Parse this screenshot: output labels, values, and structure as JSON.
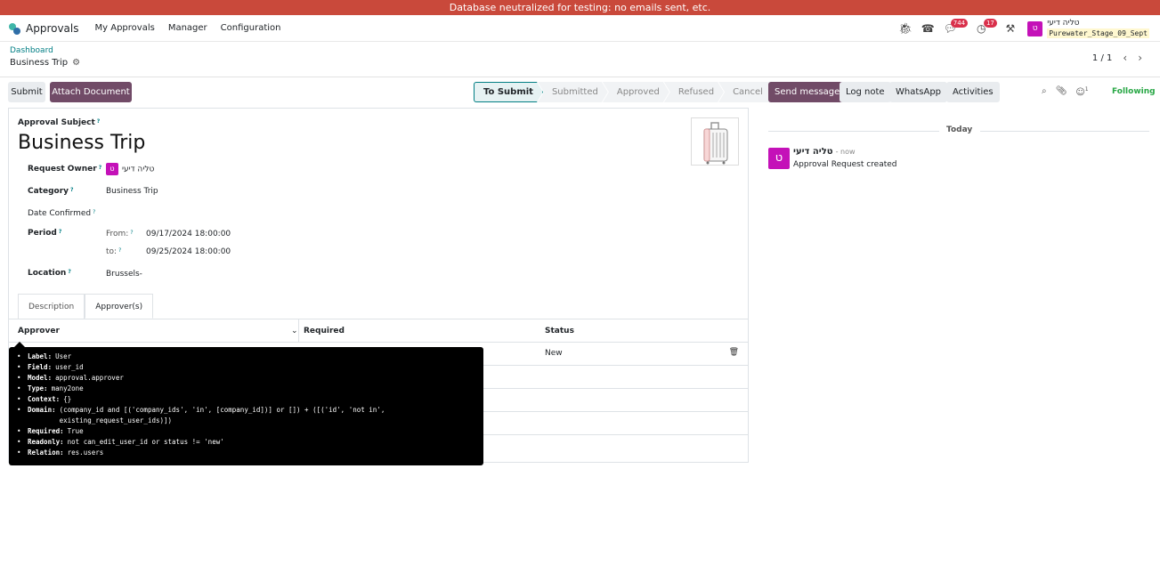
{
  "banner": "Database neutralized for testing: no emails sent, etc.",
  "navbar": {
    "app_name": "Approvals",
    "menu": [
      "My Approvals",
      "Manager",
      "Configuration"
    ],
    "messages_count": "744",
    "activities_count": "17",
    "user_initial": "ט",
    "user_name": "טליה דיעי",
    "db_name": "Purewater_Stage_09_Sept"
  },
  "control": {
    "breadcrumb": "Dashboard",
    "record_title": "Business Trip",
    "pager": "1 / 1"
  },
  "actions": {
    "submit": "Submit",
    "attach": "Attach Document"
  },
  "statusbar": [
    "To Submit",
    "Submitted",
    "Approved",
    "Refused",
    "Cancel"
  ],
  "form": {
    "subject_label": "Approval Subject",
    "subject": "Business Trip",
    "owner_label": "Request Owner",
    "owner_initial": "ט",
    "owner_name": "טליה דיעי",
    "category_label": "Category",
    "category": "Business Trip",
    "date_confirmed_label": "Date Confirmed",
    "period_label": "Period",
    "from_label": "From:",
    "from_value": "09/17/2024 18:00:00",
    "to_label": "to:",
    "to_value": "09/25/2024 18:00:00",
    "location_label": "Location",
    "location": "Brussels-"
  },
  "tabs": [
    "Description",
    "Approver(s)"
  ],
  "table": {
    "headers": [
      "Approver",
      "Required",
      "Status"
    ],
    "rows": [
      {
        "status": "New"
      }
    ]
  },
  "tooltip": [
    {
      "key": "Label:",
      "val": "User"
    },
    {
      "key": "Field:",
      "val": "user_id"
    },
    {
      "key": "Model:",
      "val": "approval.approver"
    },
    {
      "key": "Type:",
      "val": "many2one"
    },
    {
      "key": "Context:",
      "val": "{}"
    },
    {
      "key": "Domain:",
      "val": "(company_id and [('company_ids', 'in', [company_id])] or []) + ([('id', 'not in',\nexisting_request_user_ids)])"
    },
    {
      "key": "Required:",
      "val": "True"
    },
    {
      "key": "Readonly:",
      "val": "not can_edit_user_id or status != 'new'"
    },
    {
      "key": "Relation:",
      "val": "res.users"
    }
  ],
  "chatter": {
    "send_message": "Send message",
    "log_note": "Log note",
    "whatsapp": "WhatsApp",
    "activities": "Activities",
    "followers_count": "1",
    "following": "Following",
    "today": "Today",
    "author_initial": "ט",
    "author": "טליה דיעי",
    "time": "- now",
    "message": "Approval Request created"
  }
}
